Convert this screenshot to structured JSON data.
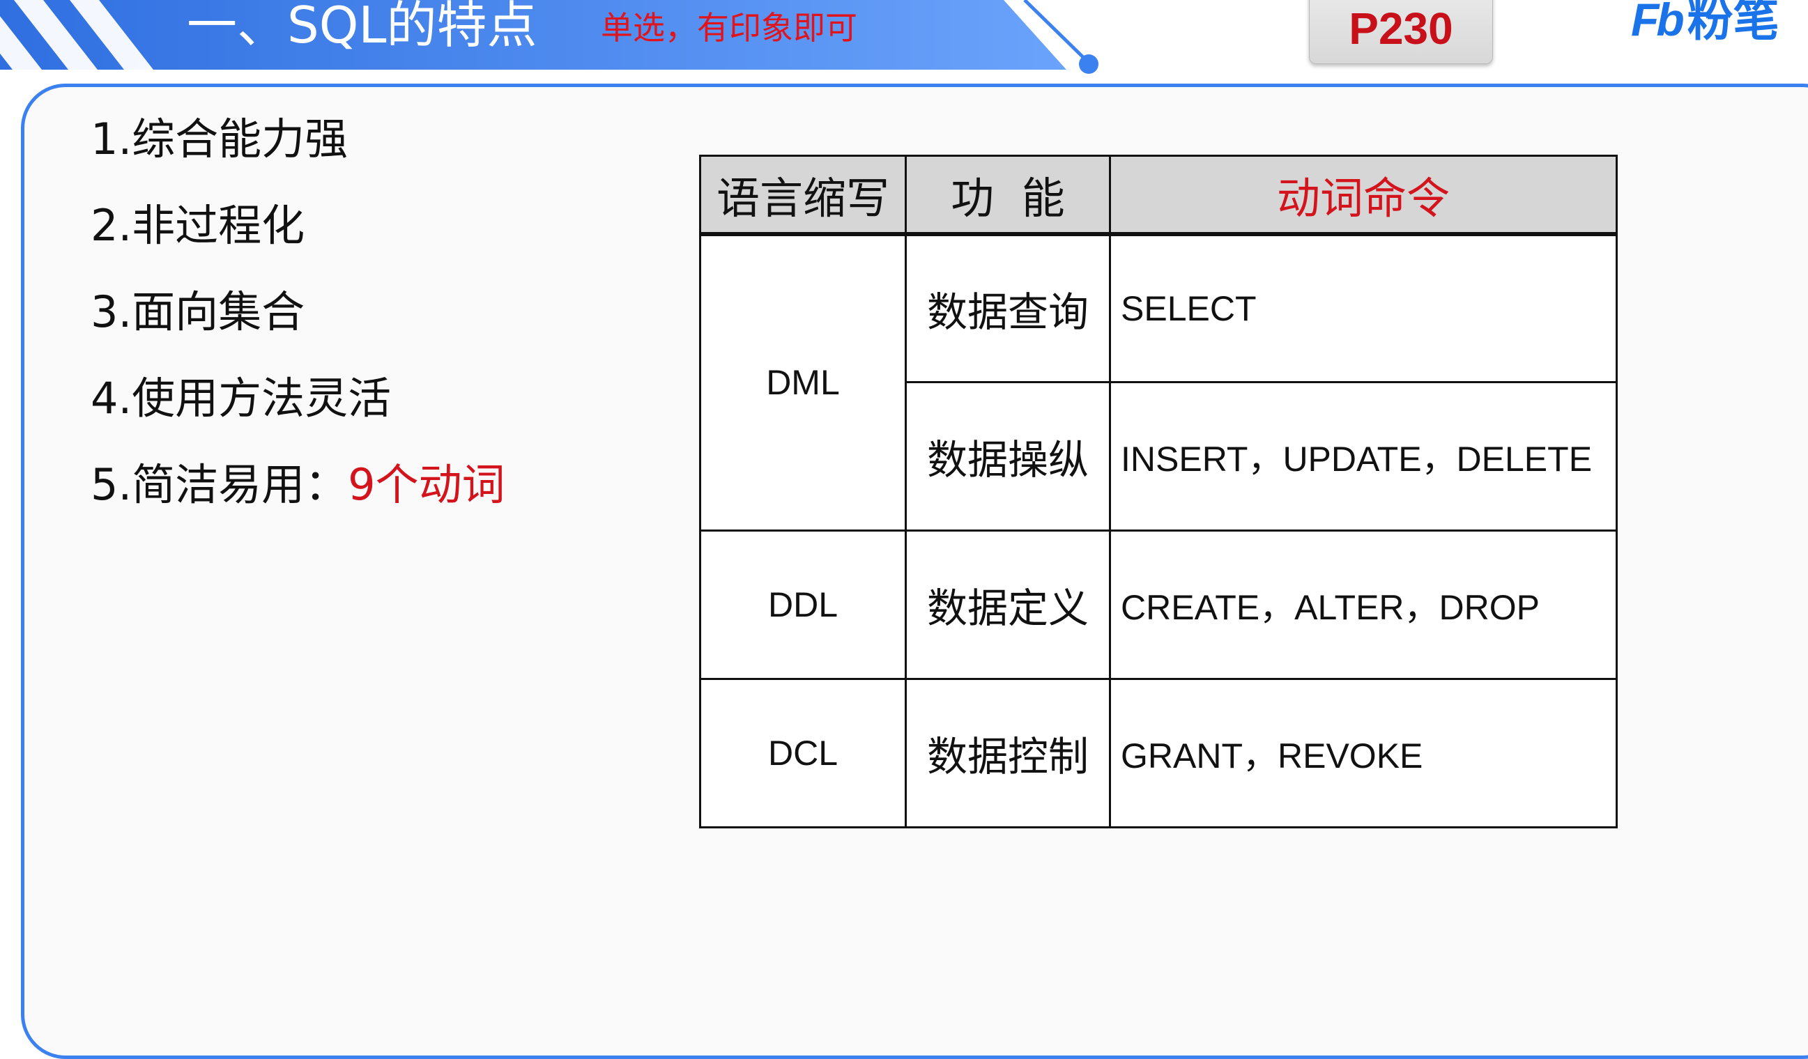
{
  "header": {
    "title": "一、SQL的特点",
    "note": "单选，有印象即可",
    "page_number": "P230",
    "brand_mark": "Fb",
    "brand_name": "粉笔"
  },
  "colors": {
    "banner_blue": "#3b82f0",
    "accent_red": "#d4141c",
    "panel_border": "#3b82f0",
    "table_header_bg": "#d6d6d6"
  },
  "points": [
    {
      "text": "1.综合能力强"
    },
    {
      "text": "2.非过程化"
    },
    {
      "text": "3.面向集合"
    },
    {
      "text": "4.使用方法灵活"
    },
    {
      "text": "5.简洁易用：",
      "highlight": "9个动词"
    }
  ],
  "table": {
    "headers": [
      "语言缩写",
      "功  能",
      "动词命令"
    ],
    "rows": [
      {
        "abbr": "DML",
        "function": "数据查询",
        "commands": "SELECT"
      },
      {
        "abbr": "",
        "function": "数据操纵",
        "commands": "INSERT，UPDATE，DELETE"
      },
      {
        "abbr": "DDL",
        "function": "数据定义",
        "commands": "CREATE，ALTER，DROP"
      },
      {
        "abbr": "DCL",
        "function": "数据控制",
        "commands": "GRANT，REVOKE"
      }
    ]
  }
}
